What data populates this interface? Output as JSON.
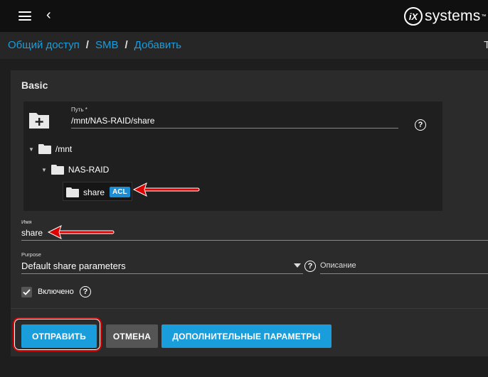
{
  "topbar": {
    "brand_mark": "iX",
    "brand_text": "systems",
    "brand_tm": "™",
    "back_glyph": "‹"
  },
  "breadcrumb": {
    "items": [
      "Общий доступ",
      "SMB",
      "Добавить"
    ],
    "separator": "/",
    "edge_text": "T"
  },
  "form": {
    "section_title": "Basic",
    "path": {
      "label": "Путь *",
      "value": "/mnt/NAS-RAID/share",
      "help": "?"
    },
    "tree": {
      "root": "/mnt",
      "child": "NAS-RAID",
      "leaf": "share",
      "leaf_badge": "ACL"
    },
    "name": {
      "label": "Имя",
      "value": "share"
    },
    "purpose": {
      "label": "Purpose",
      "value": "Default share parameters",
      "help": "?"
    },
    "description": {
      "placeholder": "Описание"
    },
    "enabled": {
      "label": "Включено",
      "checked": true,
      "help": "?"
    }
  },
  "buttons": {
    "submit": "ОТПРАВИТЬ",
    "cancel": "ОТМЕНА",
    "advanced": "ДОПОЛНИТЕЛЬНЫЕ ПАРАМЕТРЫ"
  },
  "colors": {
    "accent": "#1a9ddb",
    "badge": "#1a8fd6",
    "annotation": "#dd0000"
  }
}
